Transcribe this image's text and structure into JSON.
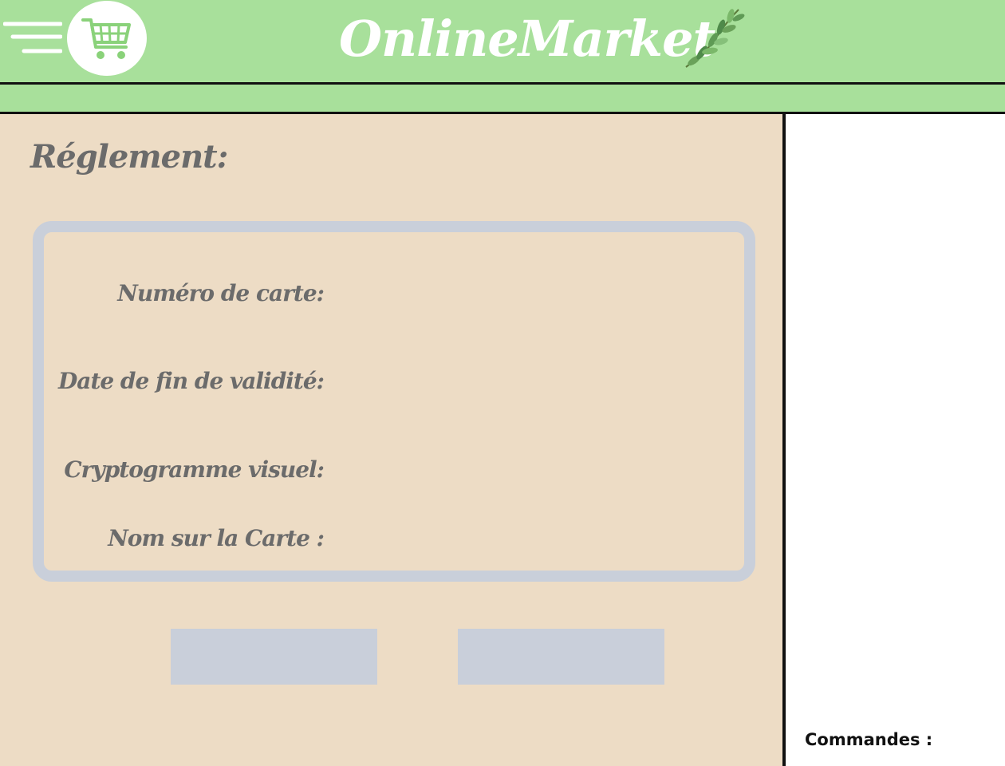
{
  "header": {
    "app_title": "OnlineMarket",
    "menu_icon": "hamburger-menu-icon",
    "logo_icon": "shopping-cart-icon",
    "decoration_icon": "olive-branch-icon"
  },
  "main": {
    "page_title": "Réglement:",
    "form": {
      "card_number_label": "Numéro de carte:",
      "card_number_value": "",
      "expiry_label": "Date de fin de validité:",
      "expiry_value": "",
      "cvv_label": "Cryptogramme visuel:",
      "cvv_value": "",
      "name_label": "Nom sur la Carte :",
      "name_value": ""
    },
    "buttons": {
      "left_label": "",
      "right_label": ""
    }
  },
  "sidebar": {
    "orders_label": "Commandes :"
  },
  "colors": {
    "header_green": "#a8e09b",
    "main_beige": "#eddcc5",
    "card_border": "#c9cfda",
    "label_gray": "#6b6b6b"
  }
}
